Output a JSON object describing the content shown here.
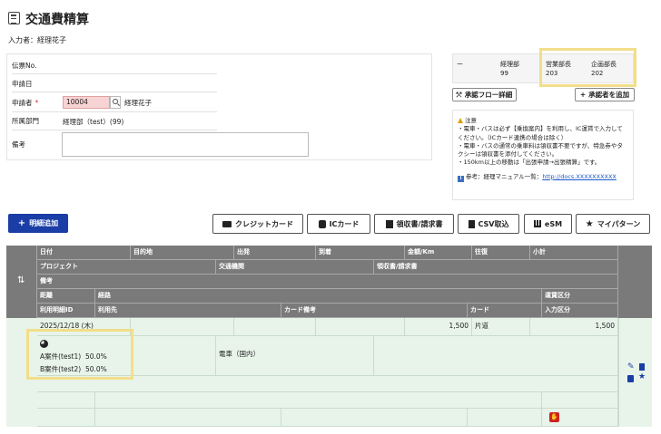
{
  "header": {
    "title": "交通費精算",
    "entrant": "入力者：経理花子"
  },
  "form": {
    "slip_no_label": "伝票No.",
    "apply_date_label": "申請日",
    "applicant_label": "申請者",
    "required_mark": "*",
    "applicant_code": "10004",
    "applicant_name": "経理花子",
    "department_label": "所属部門",
    "department_value": "経理部（test）(99)",
    "remarks_label": "備考"
  },
  "approval": {
    "cells": [
      {
        "label": "ー",
        "value": ""
      },
      {
        "label": "経理部",
        "value": "99"
      },
      {
        "label": "営業部長",
        "value": "203"
      },
      {
        "label": "企画部長",
        "value": "202"
      }
    ],
    "flow_button": "承認フロー詳細",
    "add_approver_button": "承認者を追加"
  },
  "notice": {
    "title": "注意",
    "lines": [
      "・電車・バスは必ず【乗換案内】を利用し、IC運賃で入力して",
      "ください。（ICカード連携の場合は除く）",
      "・電車・バスの通常の乗車料は領収書不要ですが、特急券やタ",
      "クシーは領収書を添付してください。",
      "・150km以上の移動は「出張申請→出張精算」です。"
    ],
    "ref_label": "参考：経理マニュアル一覧：",
    "ref_link": "http://docs.XXXXXXXXXX"
  },
  "toolbar": {
    "add_detail": "明細追加",
    "credit_card": "クレジットカード",
    "ic_card": "ICカード",
    "receipt": "領収書/請求書",
    "csv_import": "CSV取込",
    "esm": "eSM",
    "my_pattern": "マイパターン"
  },
  "table": {
    "headers_row1": [
      "日付",
      "目的地",
      "出発",
      "到着",
      "金額/Km",
      "往復",
      "小計"
    ],
    "headers_row2": [
      "プロジェクト",
      "交通機関",
      "領収書/請求書"
    ],
    "headers_row3": [
      "備考"
    ],
    "headers_row4": [
      "距離",
      "経路",
      "運賃区分"
    ],
    "headers_row5": [
      "利用明細ID",
      "利用先",
      "カード備考",
      "カード",
      "入力区分"
    ],
    "row": {
      "date": "2025/12/18 (木)",
      "amount": "1,500",
      "roundtrip": "片道",
      "subtotal": "1,500",
      "project1": "A案件(test1)",
      "project1_pct": "50.0%",
      "project2": "B案件(test2)",
      "project2_pct": "50.0%",
      "transport": "電車（国内）"
    }
  },
  "colors": {
    "primary": "#1a3da6",
    "header_gray": "#7a7a7a",
    "row_green": "#e8f4ea",
    "highlight": "#f2de8a",
    "required_input": "#f8d3d3",
    "danger": "#cc2222"
  }
}
